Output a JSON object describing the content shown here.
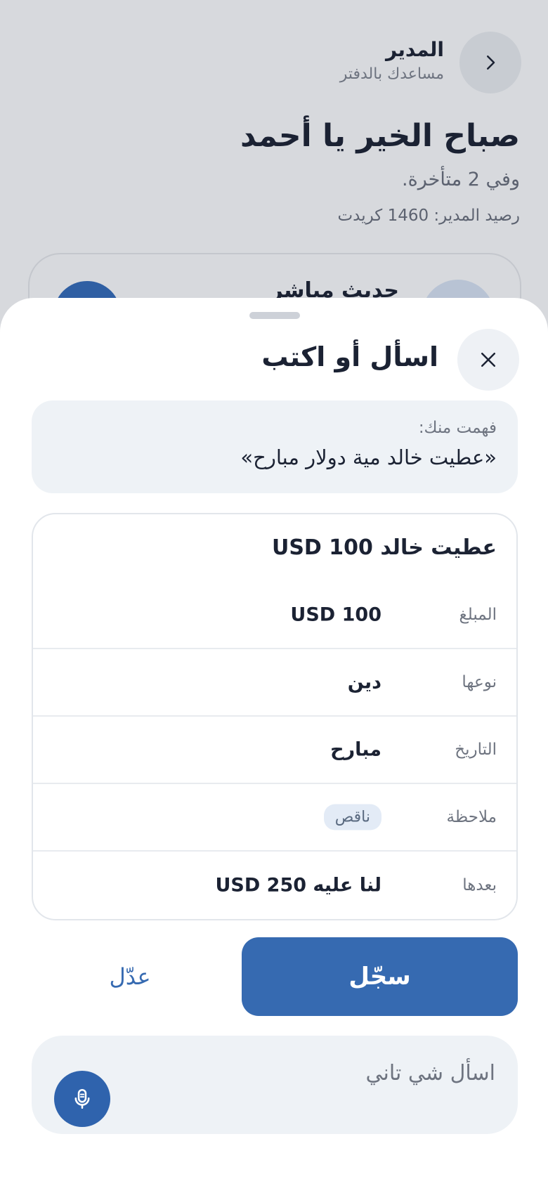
{
  "header": {
    "title": "المدير",
    "subtitle": "مساعدك بالدفتر"
  },
  "greeting": "صباح الخير يا أحمد",
  "late_text": "وفي 2 متأخرة.",
  "balance_text": "رصيد المدير: 1460 كريدت",
  "bg_card": {
    "label": "حديث مباشر"
  },
  "sheet": {
    "title": "اسأل أو اكتب",
    "understood_label": "فهمت منك:",
    "understood_quote": "«عطيت خالد مية دولار مبارح»",
    "details": {
      "title": "عطيت خالد 100 USD",
      "rows": [
        {
          "label": "المبلغ",
          "value": "100 USD"
        },
        {
          "label": "نوعها",
          "value": "دين"
        },
        {
          "label": "التاريخ",
          "value": "مبارح"
        },
        {
          "label": "ملاحظة",
          "badge": "ناقص"
        },
        {
          "label": "بعدها",
          "value": "لنا عليه 250 USD"
        }
      ]
    },
    "save_label": "سجّل",
    "edit_label": "عدّل",
    "ask_placeholder": "اسأل شي تاني"
  },
  "icons": {
    "back": "chevron-right-icon",
    "close": "close-icon",
    "mic": "microphone-icon"
  },
  "colors": {
    "accent": "#366ab1",
    "background": "#d7d9dd"
  }
}
